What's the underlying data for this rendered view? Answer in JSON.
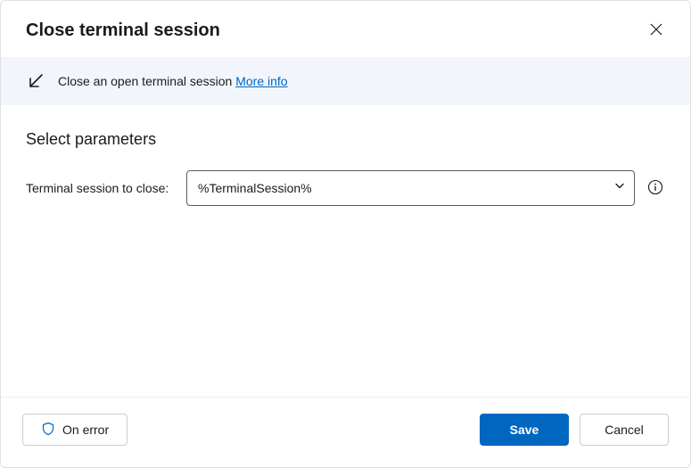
{
  "header": {
    "title": "Close terminal session"
  },
  "banner": {
    "description": "Close an open terminal session",
    "more_info_label": "More info"
  },
  "content": {
    "section_title": "Select parameters",
    "field_label": "Terminal session to close:",
    "field_value": "%TerminalSession%"
  },
  "footer": {
    "on_error_label": "On error",
    "save_label": "Save",
    "cancel_label": "Cancel"
  }
}
